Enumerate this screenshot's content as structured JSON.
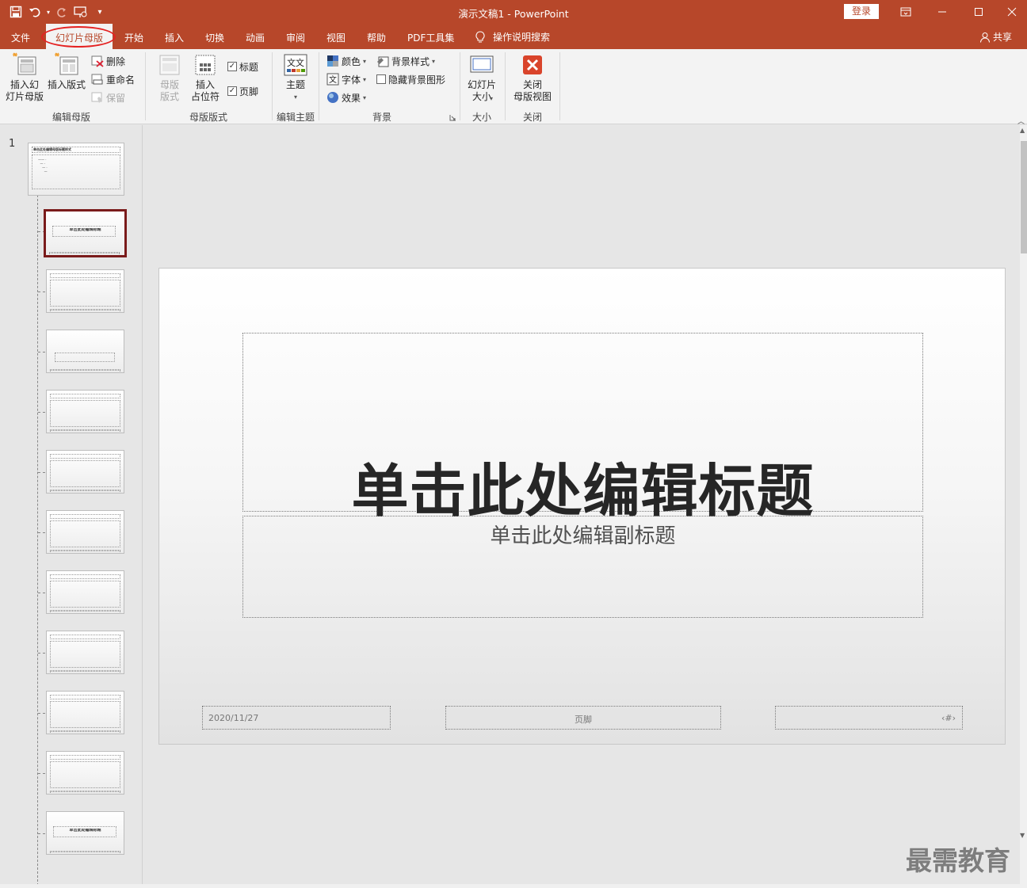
{
  "window": {
    "title": "演示文稿1 - PowerPoint",
    "login_label": "登录"
  },
  "colors": {
    "accent": "#b7472a",
    "selected_thumb_border": "#7a1b1b",
    "highlight_ellipse": "#e52222"
  },
  "quick_access": {
    "icons": [
      "save-icon",
      "undo-icon",
      "redo-icon",
      "present-from-beginning-icon",
      "customize-qat-icon"
    ]
  },
  "tabs": {
    "file": "文件",
    "slide_master": "幻灯片母版",
    "home": "开始",
    "insert": "插入",
    "transitions": "切换",
    "animations": "动画",
    "review": "审阅",
    "view": "视图",
    "help": "帮助",
    "pdf_tools": "PDF工具集",
    "tell_me": "操作说明搜索",
    "share": "共享"
  },
  "ribbon": {
    "insert_slide_master": "插入幻\n灯片母版",
    "insert_layout": "插入版式",
    "delete": "删除",
    "rename": "重命名",
    "preserve": "保留",
    "group_edit_master": "编辑母版",
    "master_layout": "母版\n版式",
    "insert_placeholder": "插入\n占位符",
    "title_checkbox": "标题",
    "footers_checkbox": "页脚",
    "group_master_layout": "母版版式",
    "themes": "主题",
    "group_edit_theme": "编辑主题",
    "colors": "颜色",
    "fonts": "字体",
    "effects": "效果",
    "background_styles": "背景样式",
    "hide_background_graphics": "隐藏背景图形",
    "group_background": "背景",
    "slide_size": "幻灯片\n大小",
    "group_size": "大小",
    "close_master_view": "关闭\n母版视图",
    "group_close": "关闭",
    "title_checked": true,
    "footers_checked": true,
    "hide_bg_checked": false
  },
  "thumbnails": {
    "slide_number": "1",
    "master_title": "单击此处编辑母版标题样式",
    "layout_title": "单击此处编辑标题",
    "layout_count": 11,
    "selected_index": 0
  },
  "slide": {
    "title": "单击此处编辑标题",
    "subtitle": "单击此处编辑副标题",
    "date": "2020/11/27",
    "footer": "页脚",
    "page_number": "‹#›"
  },
  "watermark": "最需教育"
}
